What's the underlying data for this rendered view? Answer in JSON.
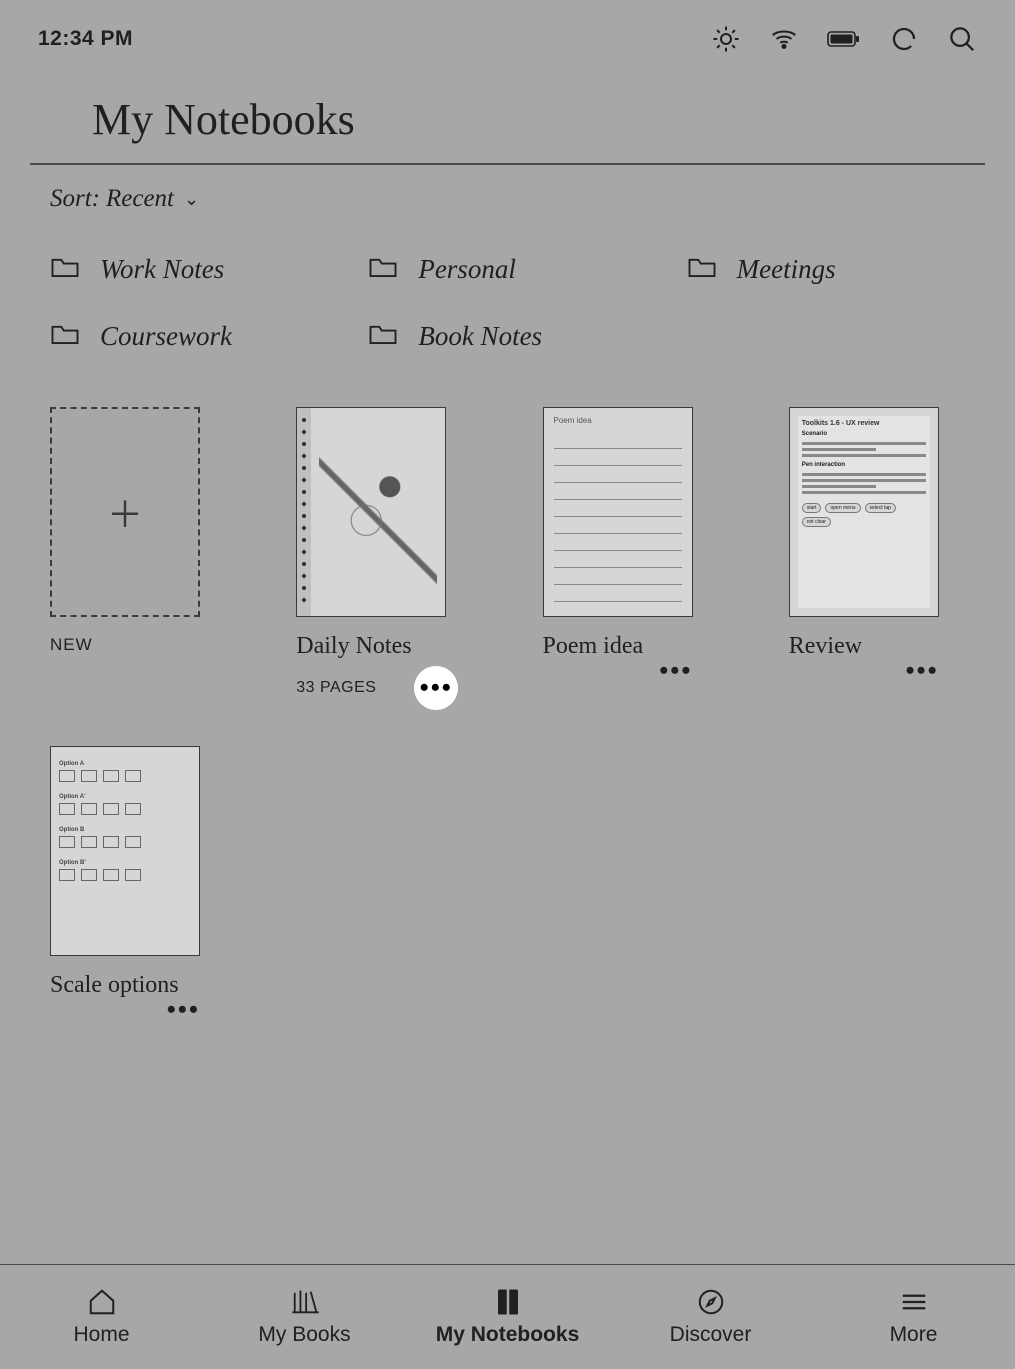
{
  "status": {
    "time": "12:34 PM"
  },
  "page": {
    "title": "My Notebooks"
  },
  "sort": {
    "label_prefix": "Sort: ",
    "value": "Recent"
  },
  "folders": [
    {
      "name": "Work Notes"
    },
    {
      "name": "Personal"
    },
    {
      "name": "Meetings"
    },
    {
      "name": "Coursework"
    },
    {
      "name": "Book Notes"
    }
  ],
  "new_label": "NEW",
  "notebooks": [
    {
      "title": "Daily Notes",
      "pages_label": "33 PAGES",
      "thumb_kind": "sketch",
      "more_highlighted": true
    },
    {
      "title": "Poem idea",
      "thumb_kind": "lined",
      "thumb_heading": "Poem idea"
    },
    {
      "title": "Review",
      "thumb_kind": "doc",
      "thumb_heading": "Toolkits 1.6 - UX review"
    },
    {
      "title": "Scale options",
      "thumb_kind": "options"
    }
  ],
  "nav": [
    {
      "label": "Home",
      "active": false
    },
    {
      "label": "My Books",
      "active": false
    },
    {
      "label": "My Notebooks",
      "active": true
    },
    {
      "label": "Discover",
      "active": false
    },
    {
      "label": "More",
      "active": false
    }
  ]
}
